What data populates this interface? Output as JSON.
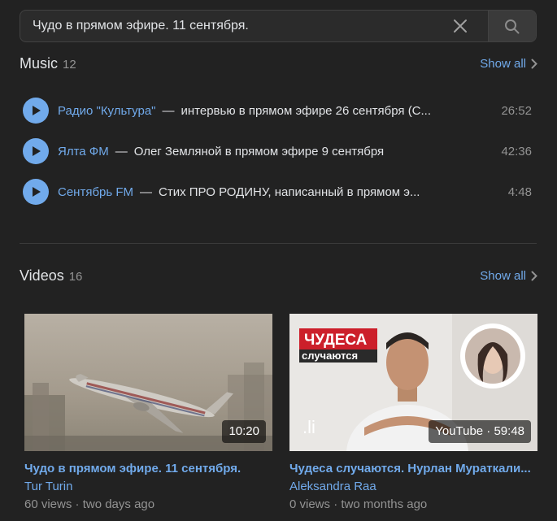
{
  "search": {
    "value": "Чудо в прямом эфире. 11 сентября.",
    "clear_icon": "close-icon",
    "search_icon": "search-icon"
  },
  "music": {
    "title": "Music",
    "count": "12",
    "show_all": "Show all",
    "tracks": [
      {
        "artist": "Радио \"Культура\"",
        "dash": "—",
        "title": "интервью в прямом эфире 26 сентября (С...",
        "duration": "26:52"
      },
      {
        "artist": "Ялта ФМ",
        "dash": "—",
        "title": "Олег Земляной в прямом эфире 9 сентября",
        "duration": "42:36"
      },
      {
        "artist": "Сентябрь FM",
        "dash": "—",
        "title": "Стих ПРО РОДИНУ, написанный в прямом э...",
        "duration": "4:48"
      }
    ]
  },
  "videos": {
    "title": "Videos",
    "count": "16",
    "show_all": "Show all",
    "items": [
      {
        "duration": "10:20",
        "title": "Чудо в прямом эфире. 11 сентября.",
        "author": "Tur Turin",
        "views": "60 views",
        "sep": "·",
        "date": "two days ago"
      },
      {
        "duration": "YouTube · 59:48",
        "title": "Чудеса случаются. Нурлан Мураткали...",
        "author": "Aleksandra Raa",
        "views": "0 views",
        "sep": "·",
        "date": "two months ago",
        "thumb_text": {
          "line1": "ЧУДЕСА",
          "line2": "случаются",
          "logo": ".li"
        }
      }
    ]
  },
  "colors": {
    "background": "#222222",
    "accent": "#71aaeb",
    "text": "#e1e3e6",
    "muted": "#939393"
  }
}
